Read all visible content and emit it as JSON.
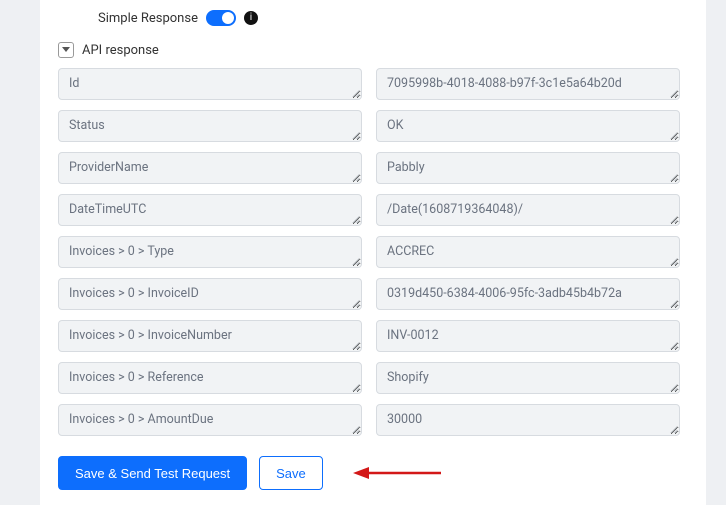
{
  "header": {
    "simple_response_label": "Simple Response",
    "info_glyph": "i"
  },
  "section": {
    "title": "API response"
  },
  "rows": [
    {
      "key": "Id",
      "value": "7095998b-4018-4088-b97f-3c1e5a64b20d"
    },
    {
      "key": "Status",
      "value": "OK"
    },
    {
      "key": "ProviderName",
      "value": "Pabbly"
    },
    {
      "key": "DateTimeUTC",
      "value": "/Date(1608719364048)/"
    },
    {
      "key": "Invoices > 0 > Type",
      "value": "ACCREC"
    },
    {
      "key": "Invoices > 0 > InvoiceID",
      "value": "0319d450-6384-4006-95fc-3adb45b4b72a"
    },
    {
      "key": "Invoices > 0 > InvoiceNumber",
      "value": "INV-0012"
    },
    {
      "key": "Invoices > 0 > Reference",
      "value": "Shopify"
    },
    {
      "key": "Invoices > 0 > AmountDue",
      "value": "30000"
    }
  ],
  "buttons": {
    "save_send": "Save & Send Test Request",
    "save": "Save"
  },
  "colors": {
    "primary": "#0d6efd",
    "field_bg": "#f1f3f5",
    "field_border": "#d7dbe0",
    "text_muted": "#6b7380",
    "arrow": "#d31818"
  }
}
